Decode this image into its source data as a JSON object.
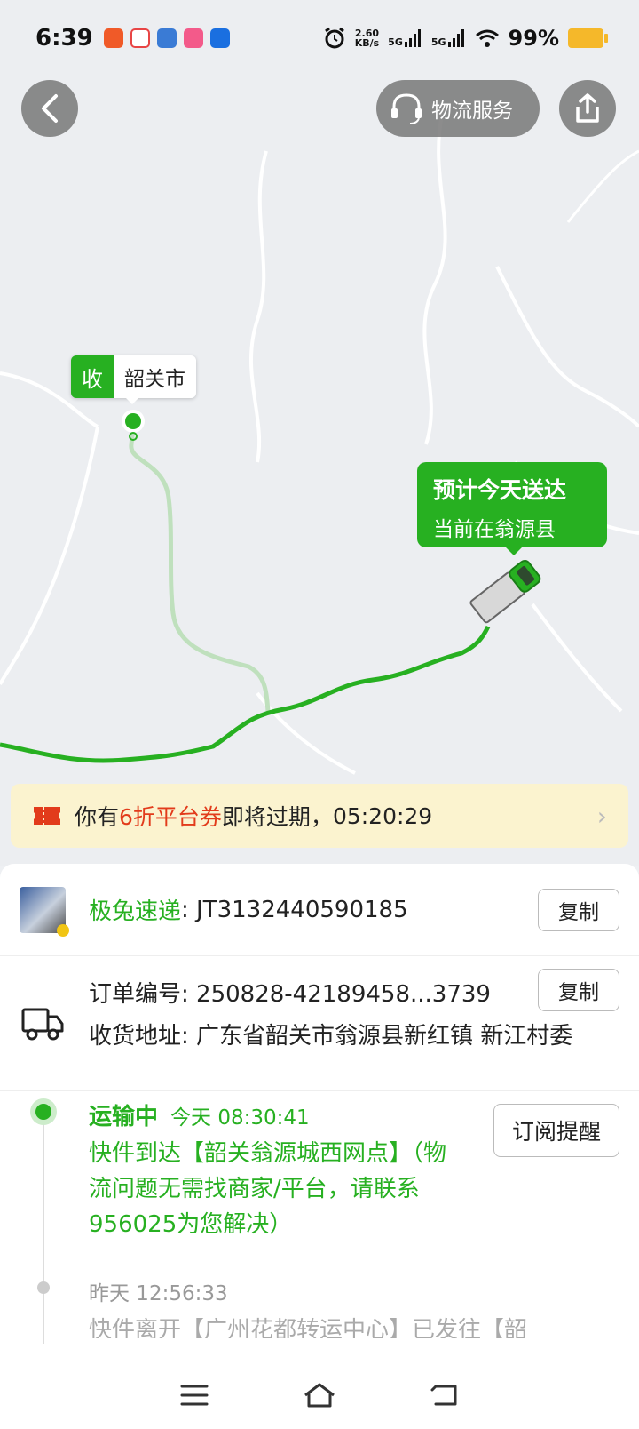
{
  "status_bar": {
    "time": "6:39",
    "net_speed_value": "2.60",
    "net_speed_unit": "KB/s",
    "network_1": "5G",
    "network_2": "5G",
    "battery": "99%",
    "app_icon_colors": [
      "#f05a28",
      "#e84545",
      "#3a7bd5",
      "#f35a8a",
      "#1a6fe0"
    ]
  },
  "header": {
    "back_icon": "chevron-left-icon",
    "service_label": "物流服务",
    "service_icon": "headset-icon",
    "share_icon": "share-icon"
  },
  "map": {
    "receiver_tag": "收",
    "receiver_city": "韶关市",
    "eta_title": "预计今天送达",
    "eta_location": "当前在翁源县",
    "route_color": "#27b021"
  },
  "coupon": {
    "prefix": "你有",
    "highlight": "6折平台券",
    "suffix": "即将过期，",
    "countdown": "05:20:29"
  },
  "shipment": {
    "carrier": "极兔速递",
    "tracking_number": ": JT3132440590185",
    "copy_label": "复制",
    "order_label": "订单编号: ",
    "order_number": "250828-42189458...3739",
    "order_copy_label": "复制",
    "address_label": "收货地址: ",
    "address": "广东省韶关市翁源县新红镇 新江村委"
  },
  "timeline": {
    "subscribe_label": "订阅提醒",
    "events": [
      {
        "status": "运输中",
        "time": "今天 08:30:41",
        "description": "快件到达【韶关翁源城西网点】（物流问题无需找商家/平台，请联系956025为您解决）"
      },
      {
        "time": "昨天 12:56:33",
        "description": "快件离开【广州花都转运中心】已发往【韶"
      }
    ]
  },
  "nav": {
    "menu_icon": "menu-icon",
    "home_icon": "home-icon",
    "back_icon": "back-icon"
  }
}
